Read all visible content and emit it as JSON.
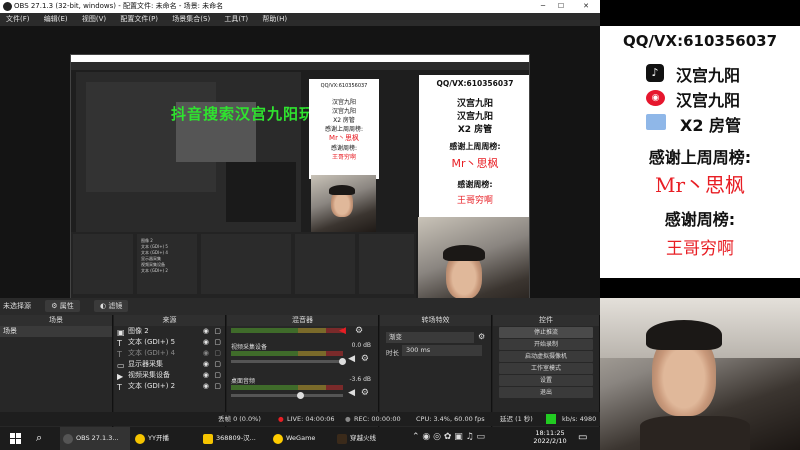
{
  "window": {
    "title": "OBS 27.1.3 (32-bit, windows) - 配置文件: 未命名 - 场景: 未命名"
  },
  "menu": [
    "文件(F)",
    "编辑(E)",
    "视图(V)",
    "配置文件(P)",
    "场景集合(S)",
    "工具(T)",
    "帮助(H)"
  ],
  "overlay": {
    "qq": "QQ/VX:610356037",
    "platforms": [
      "汉宫九阳",
      "汉宫九阳",
      "X2 房管"
    ],
    "last_week": "感谢上周周榜:",
    "last_week_name": "Mr丶思枫",
    "this_week": "感谢周榜:",
    "this_week_name": "王哥穷啊",
    "green_text": "抖音搜索汉宫九阳玩儿"
  },
  "nested_taskbar": [
    "OBS 27.1.3...",
    "368809-汉...",
    "WeGame",
    "穿越火线"
  ],
  "sourcebar": {
    "label": "未选择源",
    "props": "属性",
    "filters": "滤镜"
  },
  "docks": {
    "scenes": {
      "title": "场景",
      "items": [
        "场景"
      ]
    },
    "sources": {
      "title": "来源",
      "items": [
        {
          "icon": "image-icon",
          "label": "图像 2"
        },
        {
          "icon": "text-icon",
          "label": "文本 (GDI+) 5"
        },
        {
          "icon": "text-icon",
          "label": "文本 (GDI+) 4"
        },
        {
          "icon": "display-icon",
          "label": "显示器采集"
        },
        {
          "icon": "camera-icon",
          "label": "视频采集设备"
        },
        {
          "icon": "text-icon",
          "label": "文本 (GDI+) 2"
        }
      ]
    },
    "mixer": {
      "title": "混音器",
      "channels": [
        {
          "name": "视频采集设备",
          "db": "0.0 dB"
        },
        {
          "name": "桌面音频",
          "db": "-3.6 dB"
        }
      ]
    },
    "transitions": {
      "title": "转场特效",
      "type": "渐变",
      "duration_label": "时长",
      "duration": "300 ms"
    },
    "controls": {
      "title": "控件",
      "buttons": [
        "停止推流",
        "开始录制",
        "启动虚拟摄像机",
        "工作室模式",
        "设置",
        "退出"
      ]
    }
  },
  "status": {
    "dropped": "丢帧 0 (0.0%)",
    "live": "LIVE: 04:00:06",
    "rec": "REC: 00:00:00",
    "cpu": "CPU: 3.4%, 60.00 fps",
    "delay": "延迟 (1 秒)",
    "kbps": "kb/s: 4980"
  },
  "taskbar": {
    "apps": [
      "OBS 27.1.3...",
      "YY开播",
      "368809-汉...",
      "WeGame",
      "穿越火线"
    ],
    "time": "18:11:25",
    "date": "2022/2/10"
  },
  "colors": {
    "accent_red": "#e81e24",
    "live_green": "#22cc22",
    "obs_dark": "#2b2b2b"
  }
}
